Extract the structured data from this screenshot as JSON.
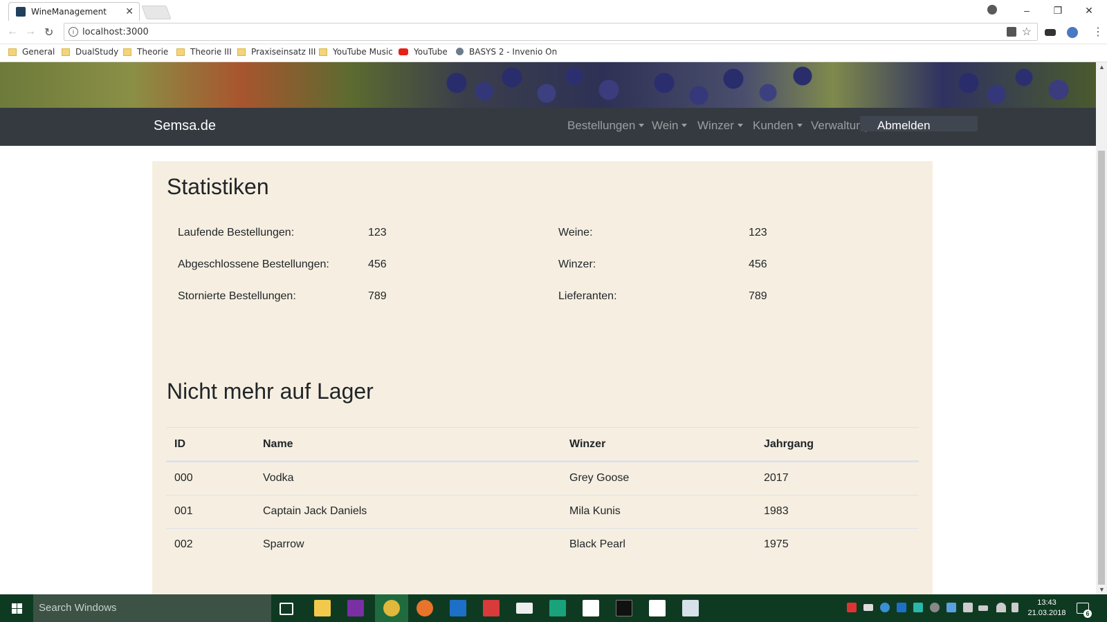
{
  "browser": {
    "tab_title": "WineManagement",
    "tab_close": "✕",
    "url": "localhost:3000",
    "window_controls": [
      "–",
      "❐",
      "✕"
    ],
    "bookmarks": [
      {
        "label": "General",
        "icon": "folder-icon"
      },
      {
        "label": "DualStudy",
        "icon": "folder-icon"
      },
      {
        "label": "Theorie",
        "icon": "folder-icon"
      },
      {
        "label": "Theorie III",
        "icon": "folder-icon"
      },
      {
        "label": "Praxiseinsatz III",
        "icon": "folder-icon"
      },
      {
        "label": "YouTube Music",
        "icon": "folder-icon"
      },
      {
        "label": "YouTube",
        "icon": "youtube-icon"
      },
      {
        "label": "BASYS 2 - Invenio On",
        "icon": "site-icon"
      }
    ]
  },
  "navbar": {
    "brand": "Semsa.de",
    "items": [
      {
        "label": "Bestellungen"
      },
      {
        "label": "Wein"
      },
      {
        "label": "Winzer"
      },
      {
        "label": "Kunden"
      },
      {
        "label": "Verwaltung"
      }
    ],
    "logout": "Abmelden"
  },
  "stats": {
    "title": "Statistiken",
    "left": [
      {
        "label": "Laufende Bestellungen:",
        "value": "123"
      },
      {
        "label": "Abgeschlossene Bestellungen:",
        "value": "456"
      },
      {
        "label": "Stornierte Bestellungen:",
        "value": "789"
      }
    ],
    "right": [
      {
        "label": "Weine:",
        "value": "123"
      },
      {
        "label": "Winzer:",
        "value": "456"
      },
      {
        "label": "Lieferanten:",
        "value": "789"
      }
    ]
  },
  "stock": {
    "title": "Nicht mehr auf Lager",
    "columns": [
      "ID",
      "Name",
      "Winzer",
      "Jahrgang"
    ],
    "rows": [
      [
        "000",
        "Vodka",
        "Grey Goose",
        "2017"
      ],
      [
        "001",
        "Captain Jack Daniels",
        "Mila Kunis",
        "1983"
      ],
      [
        "002",
        "Sparrow",
        "Black Pearl",
        "1975"
      ]
    ]
  },
  "taskbar": {
    "search_placeholder": "Search Windows",
    "time": "13:43",
    "date": "21.03.2018",
    "notifications": "6"
  },
  "colors": {
    "navbar_bg": "#343a40",
    "content_bg": "#f6efe1",
    "taskbar_bg": "#0f3a22"
  }
}
